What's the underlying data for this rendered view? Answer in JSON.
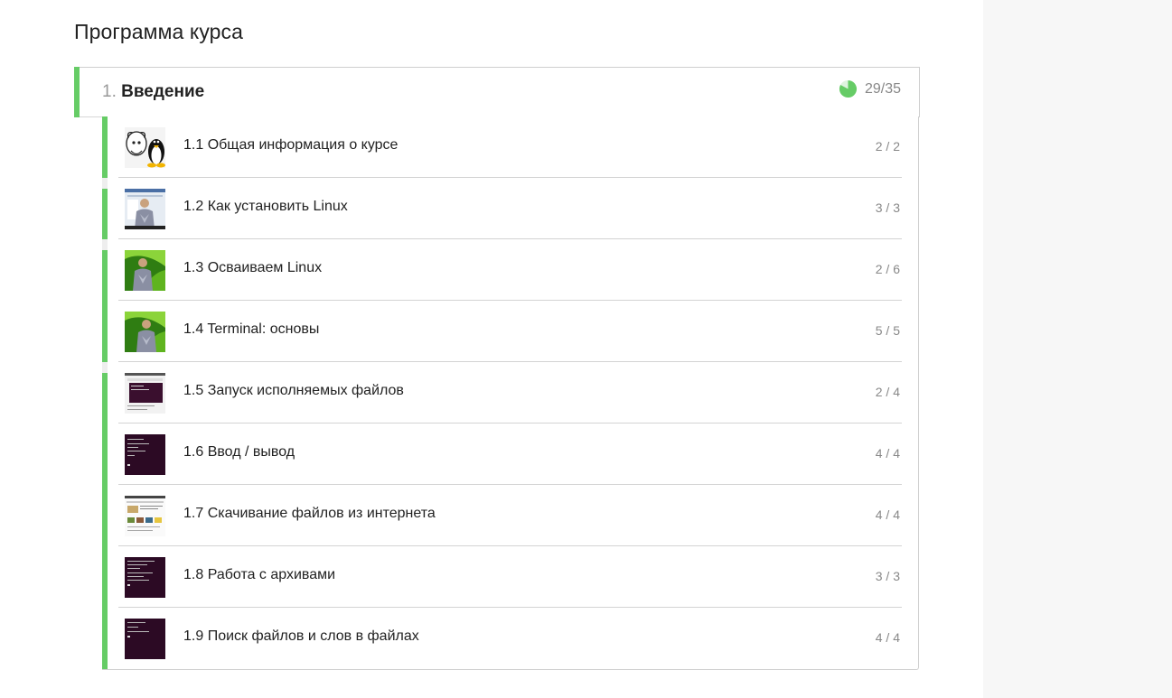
{
  "page": {
    "title": "Программа курса"
  },
  "module": {
    "number": "1.",
    "title": "Введение",
    "progress_text": "29/35",
    "progress_fraction": 0.8286,
    "accent_color": "#66cc66"
  },
  "lessons": [
    {
      "title": "1.1 Общая информация о курсе",
      "count": "2 / 2",
      "thumb": "tux-gnu-icon"
    },
    {
      "title": "1.2 Как установить Linux",
      "count": "3 / 3",
      "thumb": "presenter-video-icon"
    },
    {
      "title": "1.3 Осваиваем Linux",
      "count": "2 / 6",
      "thumb": "presenter-green-video-icon"
    },
    {
      "title": "1.4 Terminal: основы",
      "count": "5 / 5",
      "thumb": "presenter-green-video-icon"
    },
    {
      "title": "1.5 Запуск исполняемых файлов",
      "count": "2 / 4",
      "thumb": "terminal-screenshot-icon"
    },
    {
      "title": "1.6 Ввод / вывод",
      "count": "4 / 4",
      "thumb": "terminal-screenshot-icon"
    },
    {
      "title": "1.7 Скачивание файлов из интернета",
      "count": "4 / 4",
      "thumb": "website-screenshot-icon"
    },
    {
      "title": "1.8 Работа с архивами",
      "count": "3 / 3",
      "thumb": "terminal-screenshot-icon"
    },
    {
      "title": "1.9 Поиск файлов и слов в файлах",
      "count": "4 / 4",
      "thumb": "terminal-screenshot-icon"
    }
  ]
}
